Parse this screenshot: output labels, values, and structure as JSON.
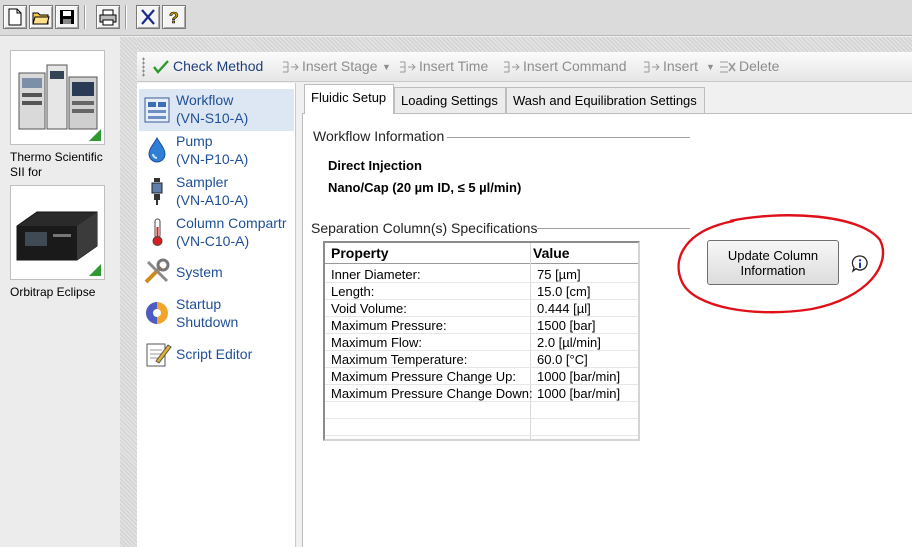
{
  "toolbar": {
    "buttons": [
      "new-file-icon",
      "open-folder-icon",
      "save-icon",
      "print-icon",
      "cut-icon",
      "help-icon"
    ]
  },
  "devices": [
    {
      "label": "Thermo Scientific SII for",
      "icon": "lc-system-icon",
      "status_color": "#2f9a2f"
    },
    {
      "label": "Orbitrap Eclipse",
      "icon": "mass-spectrometer-icon",
      "status_color": "#2f9a2f"
    }
  ],
  "method_toolbar": {
    "check_method": "Check Method",
    "insert_stage": "Insert Stage",
    "insert_time": "Insert Time",
    "insert_command": "Insert Command",
    "insert": "Insert",
    "delete": "Delete"
  },
  "nav": [
    {
      "line1": "Workflow",
      "line2": "(VN-S10-A)",
      "icon": "workflow-icon",
      "selected": true
    },
    {
      "line1": "Pump",
      "line2": "(VN-P10-A)",
      "icon": "pump-drop-icon"
    },
    {
      "line1": "Sampler",
      "line2": "(VN-A10-A)",
      "icon": "sampler-icon"
    },
    {
      "line1": "Column Compartr",
      "line2": "(VN-C10-A)",
      "icon": "thermometer-icon"
    },
    {
      "line1": "System",
      "line2": "",
      "icon": "tools-icon"
    },
    {
      "line1": "Startup",
      "line2": "Shutdown",
      "icon": "startup-shutdown-icon"
    },
    {
      "line1": "Script Editor",
      "line2": "",
      "icon": "script-editor-icon"
    }
  ],
  "tabs": [
    {
      "label": "Fluidic Setup",
      "active": true
    },
    {
      "label": "Loading Settings"
    },
    {
      "label": "Wash and Equilibration Settings"
    }
  ],
  "workflow_info": {
    "title": "Workflow Information",
    "line1": "Direct Injection",
    "line2": "Nano/Cap (20 µm ID, ≤ 5 µl/min)"
  },
  "separation": {
    "title": "Separation Column(s) Specifications",
    "headers": {
      "property": "Property",
      "value": "Value"
    },
    "rows": [
      {
        "property": "Inner Diameter:",
        "value": "75 [µm]"
      },
      {
        "property": "Length:",
        "value": "15.0 [cm]"
      },
      {
        "property": "Void Volume:",
        "value": "0.444 [µl]"
      },
      {
        "property": "Maximum Pressure:",
        "value": "1500 [bar]"
      },
      {
        "property": "Maximum Flow:",
        "value": "2.0 [µl/min]"
      },
      {
        "property": "Maximum Temperature:",
        "value": "60.0 [°C]"
      },
      {
        "property": "Maximum Pressure Change Up:",
        "value": "1000 [bar/min]"
      },
      {
        "property": "Maximum Pressure Change Down:",
        "value": "1000 [bar/min]"
      }
    ]
  },
  "update_button": {
    "line1": "Update Column",
    "line2": "Information"
  },
  "colors": {
    "accent": "#1f4f96",
    "annotation": "#e0101a",
    "selected_bg": "#dde7f3"
  }
}
